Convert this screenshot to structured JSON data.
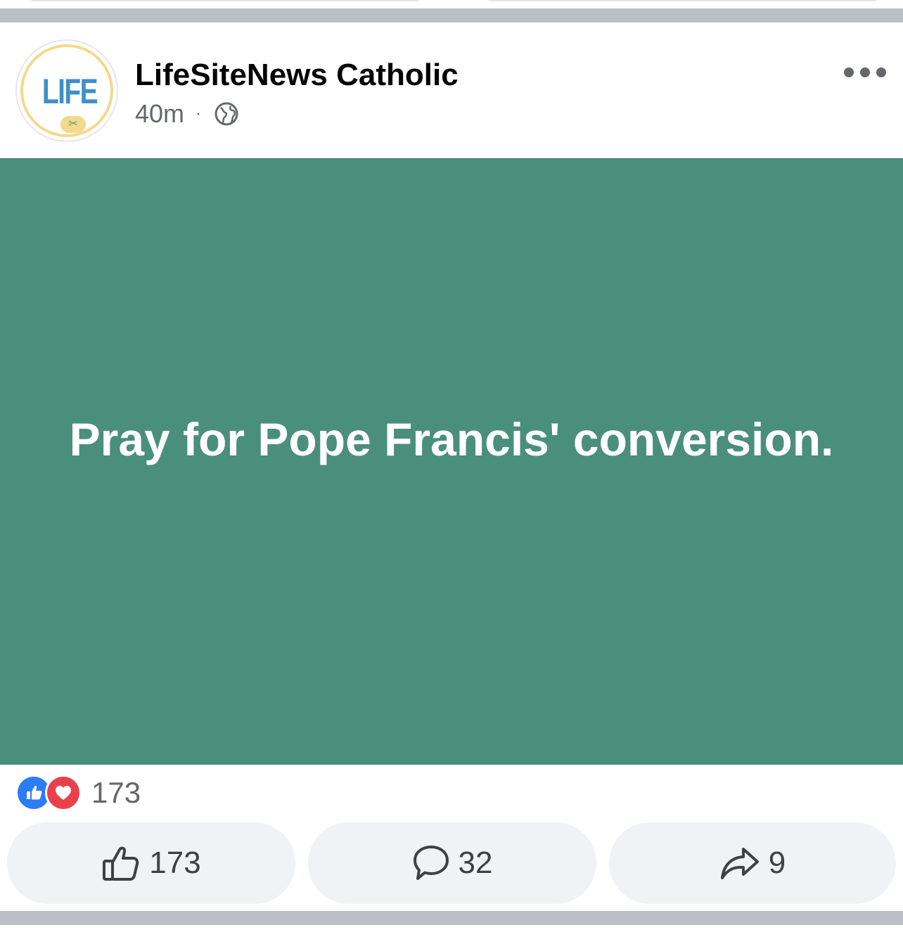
{
  "post": {
    "page_name": "LifeSiteNews Catholic",
    "timestamp": "40m",
    "separator": "·",
    "avatar_text": "LIFE",
    "privacy_icon": "globe-icon",
    "more_icon": "more-icon",
    "message": "Pray for Pope Francis' conversion.",
    "background_color": "#4a8f7c"
  },
  "reactions": {
    "icons": [
      "like-reaction-icon",
      "love-reaction-icon"
    ],
    "count": "173"
  },
  "actions": {
    "like": {
      "icon": "thumbs-up-icon",
      "count": "173"
    },
    "comment": {
      "icon": "comment-icon",
      "count": "32"
    },
    "share": {
      "icon": "share-icon",
      "count": "9"
    }
  },
  "colors": {
    "like_blue": "#2d7cf6",
    "love_red": "#e8414c",
    "button_bg": "#f0f2f5",
    "separator_gray": "#bcc0c4"
  }
}
